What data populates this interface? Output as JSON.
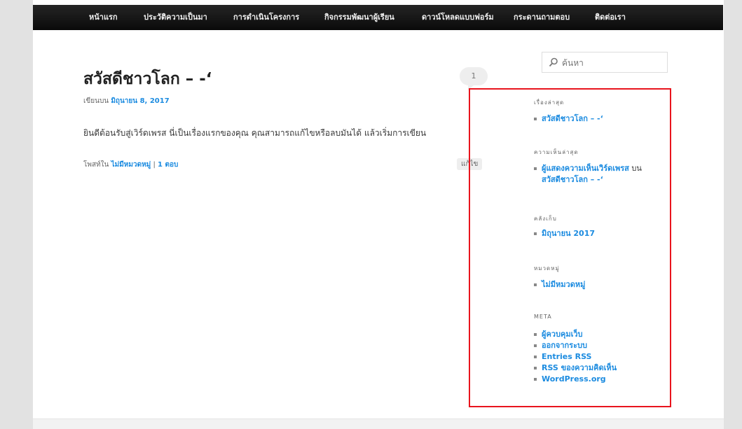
{
  "nav": {
    "items": [
      "หน้าแรก",
      "ประวัติความเป็นมา",
      "การดำเนินโครงการ",
      "กิจกรรมพัฒนาผู้เรียน",
      "ดาวน์โหลดแบบฟอร์ม",
      "กระดานถามตอบ",
      "ติดต่อเรา"
    ]
  },
  "post": {
    "title": "สวัสดีชาวโลก – -‘",
    "comment_count": "1",
    "posted_on_label": "เขียนบน",
    "date": "มิถุนายน 8, 2017",
    "body": "ยินดีต้อนรับสู่เวิร์ดเพรส นี่เป็นเรื่องแรกของคุณ คุณสามารถแก้ไขหรือลบมันได้ แล้วเริ่มการเขียน",
    "posted_in_label": "โพสท์ใน",
    "category": "ไม่มีหมวดหมู่",
    "separator": "|",
    "reply_link": "1 ตอบ",
    "edit_label": "แก้ไข"
  },
  "search": {
    "placeholder": "ค้นหา"
  },
  "sidebar": {
    "recent_posts": {
      "title": "เรื่องล่าสุด",
      "items": [
        "สวัสดีชาวโลก – -‘"
      ]
    },
    "recent_comments": {
      "title": "ความเห็นล่าสุด",
      "author": "ผู้แสดงความเห็นเวิร์ดเพรส",
      "on": "บน",
      "post": "สวัสดีชาวโลก – -‘"
    },
    "archives": {
      "title": "คลังเก็บ",
      "items": [
        "มิถุนายน 2017"
      ]
    },
    "categories": {
      "title": "หมวดหมู่",
      "items": [
        "ไม่มีหมวดหมู่"
      ]
    },
    "meta": {
      "title": "META",
      "items": [
        "ผู้ควบคุมเว็บ",
        "ออกจากระบบ",
        "Entries RSS",
        "RSS ของความคิดเห็น",
        "WordPress.org"
      ]
    }
  },
  "colors": {
    "link": "#1b8be0",
    "navbar": "#111111",
    "highlight": "#e8141d"
  }
}
